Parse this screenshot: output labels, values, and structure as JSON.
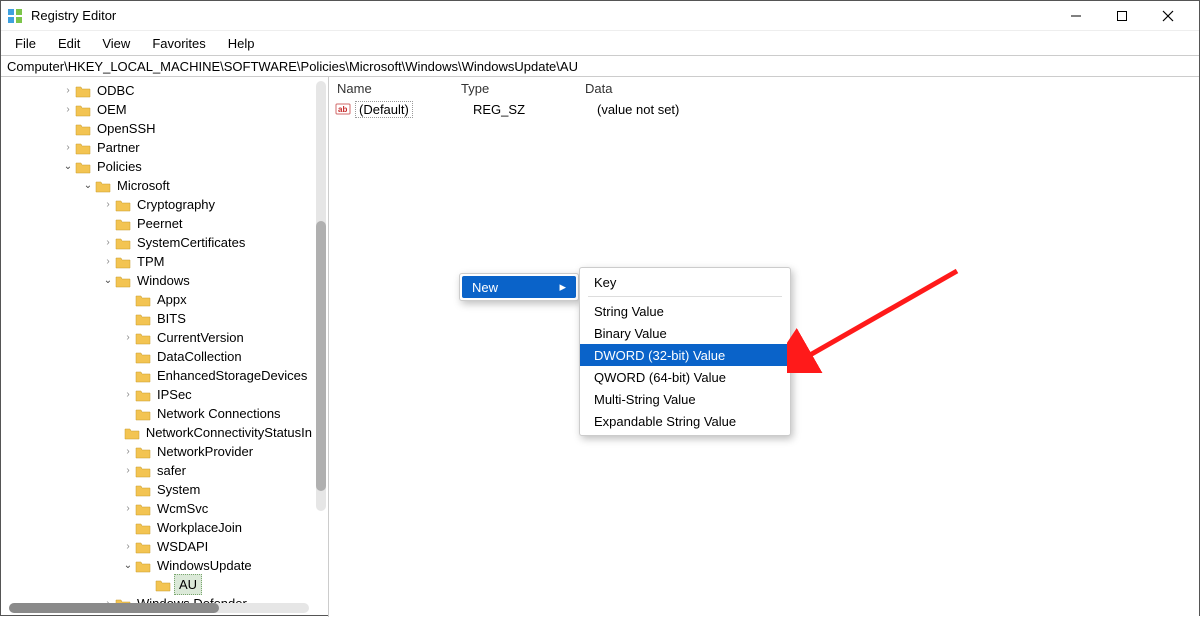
{
  "window": {
    "title": "Registry Editor"
  },
  "menu": {
    "file": "File",
    "edit": "Edit",
    "view": "View",
    "favorites": "Favorites",
    "help": "Help"
  },
  "address": "Computer\\HKEY_LOCAL_MACHINE\\SOFTWARE\\Policies\\Microsoft\\Windows\\WindowsUpdate\\AU",
  "tree": {
    "odbc": "ODBC",
    "oem": "OEM",
    "openssh": "OpenSSH",
    "partner": "Partner",
    "policies": "Policies",
    "microsoft": "Microsoft",
    "cryptography": "Cryptography",
    "peernet": "Peernet",
    "systemcertificates": "SystemCertificates",
    "tpm": "TPM",
    "windows": "Windows",
    "appx": "Appx",
    "bits": "BITS",
    "currentversion": "CurrentVersion",
    "datacollection": "DataCollection",
    "enhancedstoragedevices": "EnhancedStorageDevices",
    "ipsec": "IPSec",
    "networkconnections": "Network Connections",
    "networkconnectivitystatus": "NetworkConnectivityStatusIn",
    "networkprovider": "NetworkProvider",
    "safer": "safer",
    "system": "System",
    "wcmsvc": "WcmSvc",
    "workplacejoin": "WorkplaceJoin",
    "wsdapi": "WSDAPI",
    "windowsupdate": "WindowsUpdate",
    "au": "AU",
    "windowsdefender": "Windows Defender"
  },
  "list": {
    "header_name": "Name",
    "header_type": "Type",
    "header_data": "Data",
    "row_default_name": "(Default)",
    "row_default_type": "REG_SZ",
    "row_default_data": "(value not set)"
  },
  "context_parent": {
    "new": "New"
  },
  "context_sub": {
    "key": "Key",
    "string": "String Value",
    "binary": "Binary Value",
    "dword": "DWORD (32-bit) Value",
    "qword": "QWORD (64-bit) Value",
    "multistring": "Multi-String Value",
    "expandable": "Expandable String Value"
  }
}
